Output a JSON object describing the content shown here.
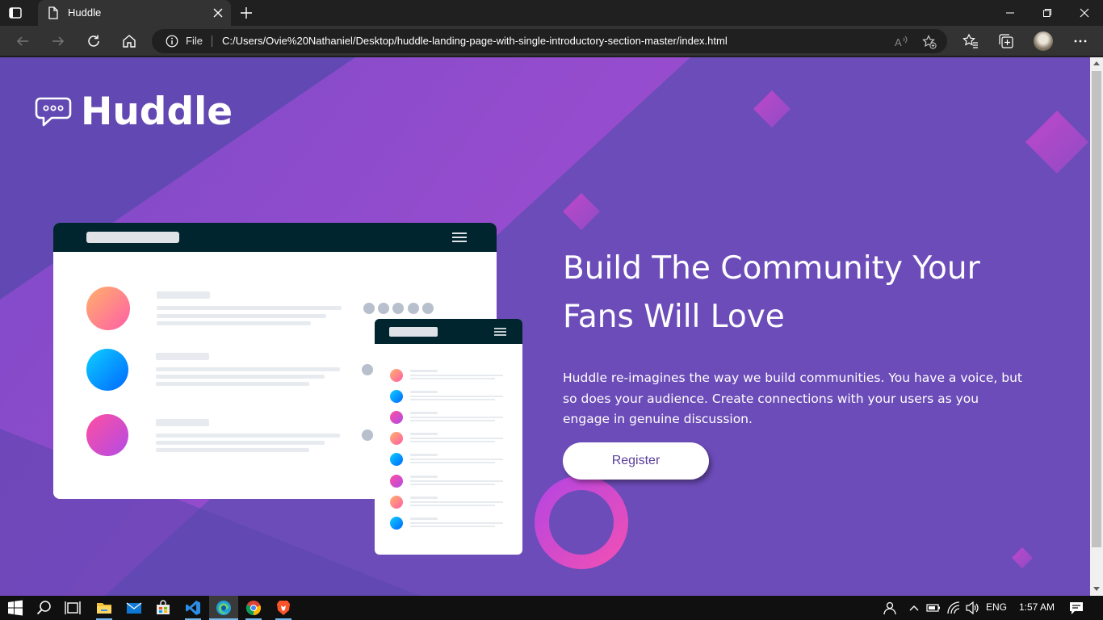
{
  "browser": {
    "tab_title": "Huddle",
    "address_prefix": "File",
    "url": "C:/Users/Ovie%20Nathaniel/Desktop/huddle-landing-page-with-single-introductory-section-master/index.html"
  },
  "page": {
    "logo_text": "Huddle",
    "headline_line1": "Build The Community Your",
    "headline_line2": "Fans Will Love",
    "lead_line1": "Huddle re-imagines the way we build communities. You have a voice, but",
    "lead_line2": "so does your audience. Create connections with your users as you",
    "lead_line3": "engage in genuine discussion.",
    "register_label": "Register",
    "colors": {
      "background": "#6c4cb8",
      "accent_magenta": "#e04bd0",
      "button_text": "#5a3d9a"
    }
  },
  "taskbar": {
    "language": "ENG",
    "time": "1:57 AM"
  },
  "icons": [
    "tab-actions-icon",
    "page-icon",
    "close-icon",
    "plus-icon",
    "minimize-icon",
    "restore-icon",
    "window-close-icon",
    "back-icon",
    "forward-icon",
    "refresh-icon",
    "home-icon",
    "info-icon",
    "read-aloud-icon",
    "add-favorite-icon",
    "favorites-icon",
    "collections-icon",
    "more-icon",
    "windows-start-icon",
    "search-icon",
    "task-view-icon",
    "file-explorer-icon",
    "mail-icon",
    "store-icon",
    "vscode-icon",
    "edge-icon",
    "chrome-icon",
    "brave-icon",
    "people-icon",
    "chevron-up-icon",
    "battery-icon",
    "wifi-icon",
    "volume-icon",
    "notification-icon"
  ]
}
